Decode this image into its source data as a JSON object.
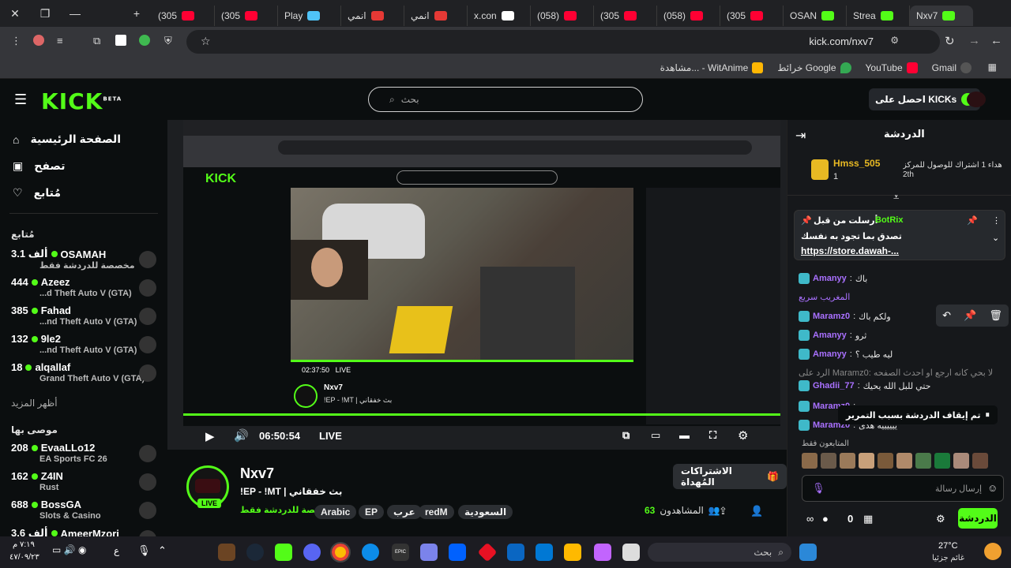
{
  "browser": {
    "tabs": [
      {
        "label": "(305",
        "color": "#ff0033"
      },
      {
        "label": "(305",
        "color": "#ff0033"
      },
      {
        "label": "Play",
        "color": "#4fc3f7"
      },
      {
        "label": "انمي",
        "color": "#e53935"
      },
      {
        "label": "انمي",
        "color": "#e53935"
      },
      {
        "label": "x.con",
        "color": "#ffffff"
      },
      {
        "label": "(058)",
        "color": "#ff0033"
      },
      {
        "label": "(305",
        "color": "#ff0033"
      },
      {
        "label": "(058)",
        "color": "#ff0033"
      },
      {
        "label": "(305",
        "color": "#ff0033"
      },
      {
        "label": "OSAN",
        "color": "#53fc18"
      },
      {
        "label": "Strea",
        "color": "#53fc18"
      },
      {
        "label": "Nxv7",
        "color": "#53fc18"
      }
    ],
    "url": "kick.com/nxv7",
    "bookmarks": [
      "Gmail",
      "YouTube",
      "خرائط Google",
      "مشاهدة... - WitAnime"
    ]
  },
  "header": {
    "logo": "KICK",
    "logo_sup": "BETA",
    "search_placeholder": "بحث",
    "get_kicks": "احصل على KICKs"
  },
  "sidebar": {
    "nav": [
      "الصفحة الرئيسية",
      "تصفح",
      "مُتابع"
    ],
    "following_title": "مُتابع",
    "following": [
      {
        "count": "3.1 ألف",
        "name": "OSAMAH",
        "sub": "مخصصة للدردشة فقط"
      },
      {
        "count": "444",
        "name": "Azeez",
        "sub": "...d Theft Auto V (GTA)"
      },
      {
        "count": "385",
        "name": "Fahad",
        "sub": "...nd Theft Auto V (GTA)"
      },
      {
        "count": "132",
        "name": "9le2",
        "sub": "...nd Theft Auto V (GTA)"
      },
      {
        "count": "18",
        "name": "alqallaf",
        "sub": "Grand Theft Auto V (GTA)"
      }
    ],
    "show_more": "أظهر المزيد",
    "recommended_title": "موصى بها",
    "recommended": [
      {
        "count": "208",
        "name": "EvaaLLo12",
        "sub": "EA Sports FC 26"
      },
      {
        "count": "162",
        "name": "Z4IN",
        "sub": "Rust"
      },
      {
        "count": "688",
        "name": "BossGA",
        "sub": "Slots & Casino"
      },
      {
        "count": "3.6 ألف",
        "name": "AmeerMzori",
        "sub": ""
      }
    ]
  },
  "player": {
    "time": "06:50:54",
    "live": "LIVE",
    "inner_time": "02:37:50",
    "inner_live": "LIVE",
    "inner_channel": "Nxv7",
    "inner_title": "!EP - !MT | بث خفقاني"
  },
  "channel": {
    "name": "Nxv7",
    "title": "!EP - !MT | بث خفقاني",
    "category": "مخصصة للدردشة فقط",
    "tags": [
      "السعودية",
      "redM",
      "عرب",
      "EP",
      "Arabic"
    ],
    "viewers_label": "المشاهدون",
    "viewers": "63",
    "gift_button": "الاشتراكات المُهداة",
    "live_badge": "LIVE"
  },
  "chat": {
    "title": "الدردشة",
    "goal_user": "Hmss_505",
    "goal_count": "1",
    "goal_text": "إهداء 1 اشتراك للوصول للمركز",
    "goal_rank": "2th",
    "pinned_header": "أرسلت من قبل",
    "pinned_user": "BotRix",
    "pinned_text": "تصدق بما تجود به نفسك",
    "pinned_link": "https://store.dawah-...",
    "messages": [
      {
        "user": "Amanyy",
        "text": "باك",
        "color": "#a970ff"
      },
      {
        "user": "",
        "text": "المغريب سريع",
        "color": "#a970ff"
      },
      {
        "user": "Maramz0",
        "text": "ولكم باك",
        "color": "#a970ff"
      },
      {
        "user": "Amanyy",
        "text": "ثرو",
        "color": "#a970ff"
      },
      {
        "user": "Amanyy",
        "text": "ليه طيب ؟",
        "color": "#a970ff"
      },
      {
        "user": "",
        "text": "الرد على Maramz0: لا بحي كانه ارجع او احدث الصفحه",
        "color": "#888888"
      },
      {
        "user": "Ghadii_77",
        "text": "حتي للبل الله يحيك",
        "color": "#a970ff"
      },
      {
        "user": "Maramz0",
        "text": "",
        "color": "#a970ff"
      },
      {
        "user": "Maramz0",
        "text": "ييييييه هدى",
        "color": "#a970ff"
      }
    ],
    "paused": "تم إيقاف الدردشة بسبب التمرير",
    "subs_only": "المتابعون فقط",
    "input_placeholder": "إرسال رسالة",
    "send_button": "الدردشة",
    "kicks_count": "0"
  },
  "taskbar": {
    "weather_temp": "27°C",
    "weather_desc": "غائم جزئيا",
    "search": "بحث",
    "time": "٧:١٩ م",
    "date": "٤٧/٠٩/٢٣",
    "lang": "ع"
  },
  "colors": {
    "accent": "#53fc18",
    "bg": "#0b0e0f",
    "chat_user": "#a970ff"
  }
}
